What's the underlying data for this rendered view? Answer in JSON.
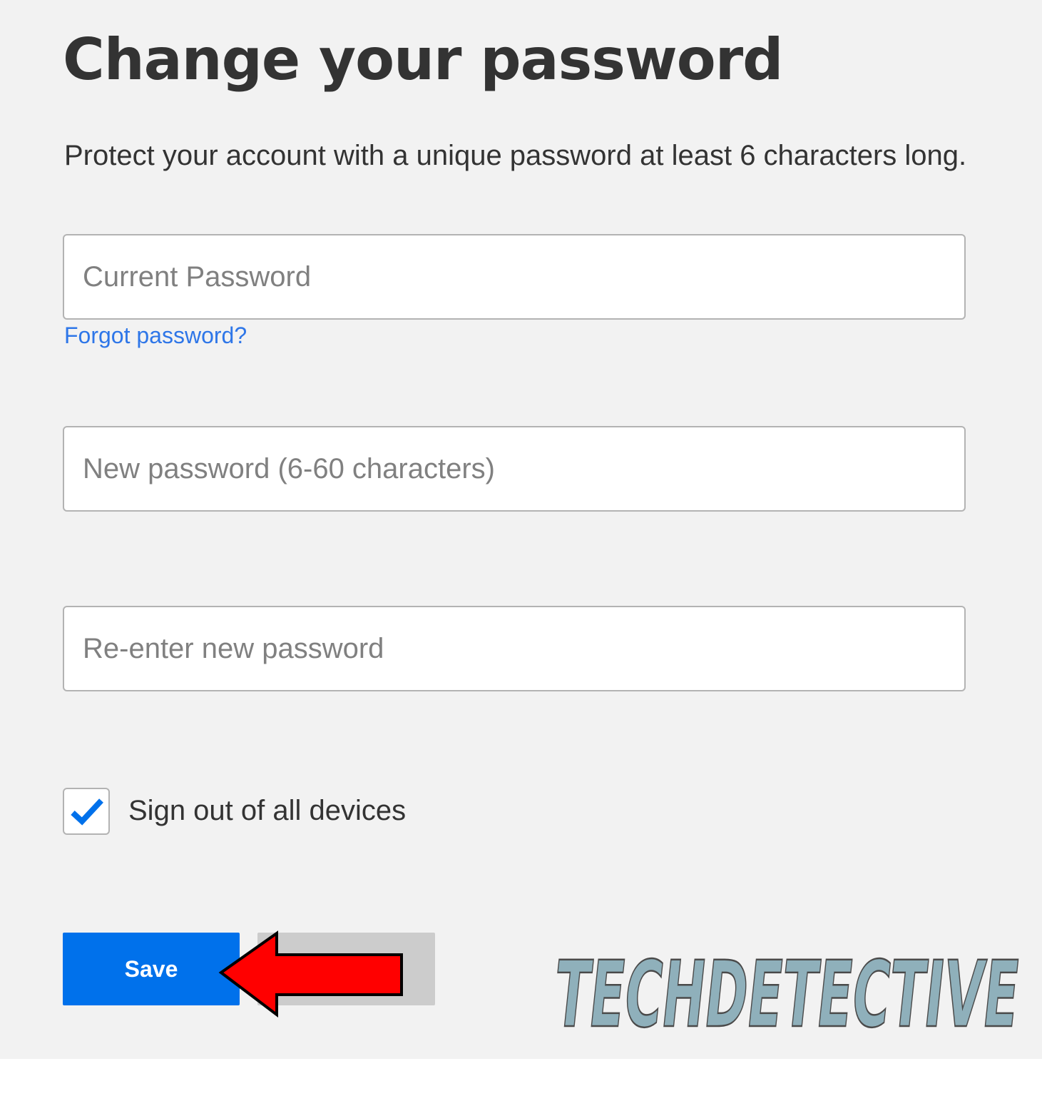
{
  "page": {
    "title": "Change your password",
    "subtitle": "Protect your account with a unique password at least 6 characters long."
  },
  "form": {
    "current_password": {
      "value": "",
      "placeholder": "Current Password"
    },
    "forgot_link": "Forgot password?",
    "new_password": {
      "value": "",
      "placeholder": "New password (6-60 characters)"
    },
    "reenter_password": {
      "value": "",
      "placeholder": "Re-enter new password"
    },
    "sign_out_all": {
      "label": "Sign out of all devices",
      "checked": true
    }
  },
  "actions": {
    "save_label": "Save",
    "cancel_label": ""
  },
  "annotation": {
    "arrow_color": "#ff0000",
    "arrow_icon": "left-arrow-icon"
  },
  "watermark": {
    "text": "TECHDETECTIVE",
    "color": "#8fb0bb"
  },
  "colors": {
    "accent": "#0071eb",
    "link": "#2e76e8",
    "background": "#f2f2f2",
    "text": "#333333"
  }
}
